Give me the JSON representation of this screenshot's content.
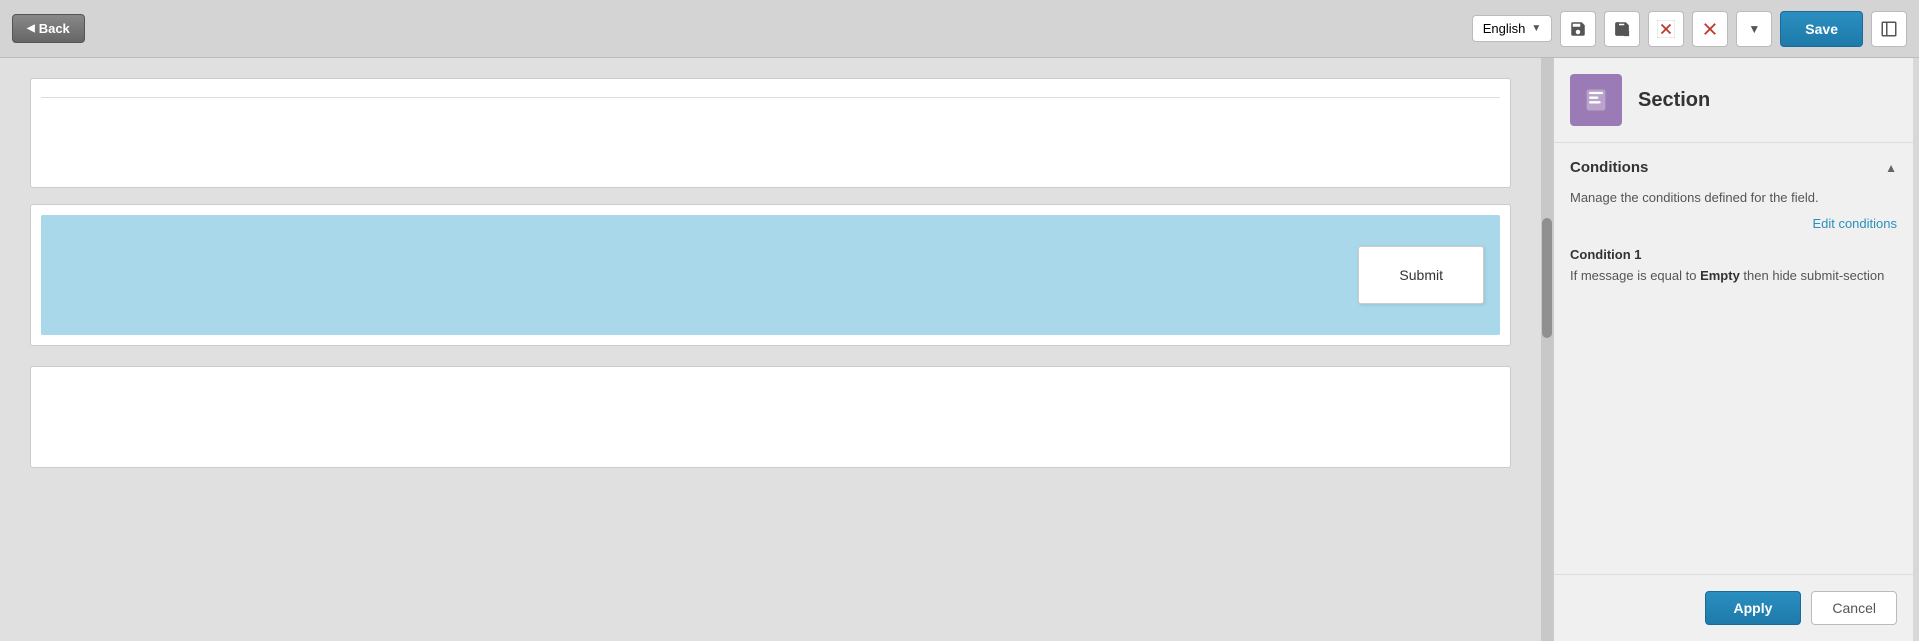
{
  "toolbar": {
    "back_label": "Back",
    "language": "English",
    "save_label": "Save",
    "icons": {
      "floppy1": "💾",
      "floppy2": "🖫",
      "cancel_x": "✕",
      "delete_x": "✕",
      "dropdown": "▼",
      "layout": "❐"
    }
  },
  "editor": {
    "submit_btn_label": "Submit"
  },
  "sidebar": {
    "section_label": "Section",
    "conditions": {
      "title": "Conditions",
      "description": "Manage the conditions defined for the field.",
      "edit_link": "Edit conditions",
      "items": [
        {
          "id": "Condition 1",
          "text_prefix": "If message is equal to ",
          "text_bold": "Empty",
          "text_suffix": " then hide submit-section"
        }
      ]
    },
    "apply_label": "Apply",
    "cancel_label": "Cancel"
  }
}
